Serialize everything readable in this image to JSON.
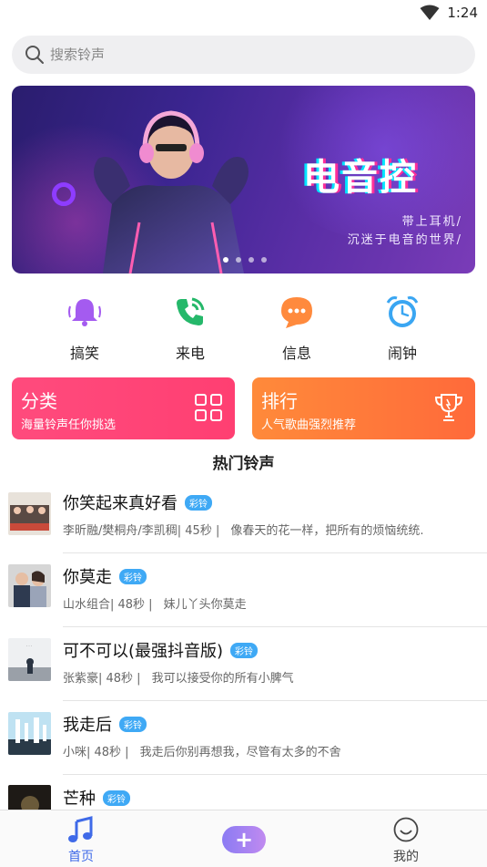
{
  "status_bar": {
    "time": "1:24"
  },
  "search": {
    "placeholder": "搜索铃声"
  },
  "banner": {
    "headline": "电音控",
    "line1": "带上耳机/",
    "line2": "沉迷于电音的世界/"
  },
  "categories": [
    {
      "label": "搞笑",
      "icon": "bell-icon",
      "color": "#a45bf0"
    },
    {
      "label": "来电",
      "icon": "phone-icon",
      "color": "#25b86a"
    },
    {
      "label": "信息",
      "icon": "chat-icon",
      "color": "#ff8a3d"
    },
    {
      "label": "闹钟",
      "icon": "alarm-clock-icon",
      "color": "#3aa6f2"
    }
  ],
  "cards": {
    "left": {
      "title": "分类",
      "subtitle": "海量铃声任你挑选",
      "icon": "grid-icon",
      "color": "#ff4b7d"
    },
    "right": {
      "title": "排行",
      "subtitle": "人气歌曲强烈推荐",
      "icon": "trophy-icon",
      "color": "#ff7d3a"
    }
  },
  "section_title": "热门铃声",
  "songs": [
    {
      "title": "你笑起来真好看",
      "tag": "彩铃",
      "meta": "李昕融/樊桐舟/李凯稠| 45秒 |",
      "desc": "像春天的花一样，把所有的烦恼统统."
    },
    {
      "title": "你莫走",
      "tag": "彩铃",
      "meta": "山水组合| 48秒 |",
      "desc": "妹儿丫头你莫走"
    },
    {
      "title": "可不可以(最强抖音版)",
      "tag": "彩铃",
      "meta": "张紫豪| 48秒 |",
      "desc": "我可以接受你的所有小脾气"
    },
    {
      "title": "我走后",
      "tag": "彩铃",
      "meta": "小咪| 48秒 |",
      "desc": "我走后你别再想我，尽管有太多的不舍"
    },
    {
      "title": "芒种",
      "tag": "彩铃",
      "meta": "",
      "desc": ""
    }
  ],
  "tabbar": {
    "home": {
      "label": "首页",
      "icon": "music-note-icon"
    },
    "add": {
      "label": "+",
      "icon": "plus-icon"
    },
    "mine": {
      "label": "我的",
      "icon": "smiley-icon"
    }
  },
  "colors": {
    "accent": "#3f6ae8",
    "tag": "#3fa9f5"
  }
}
